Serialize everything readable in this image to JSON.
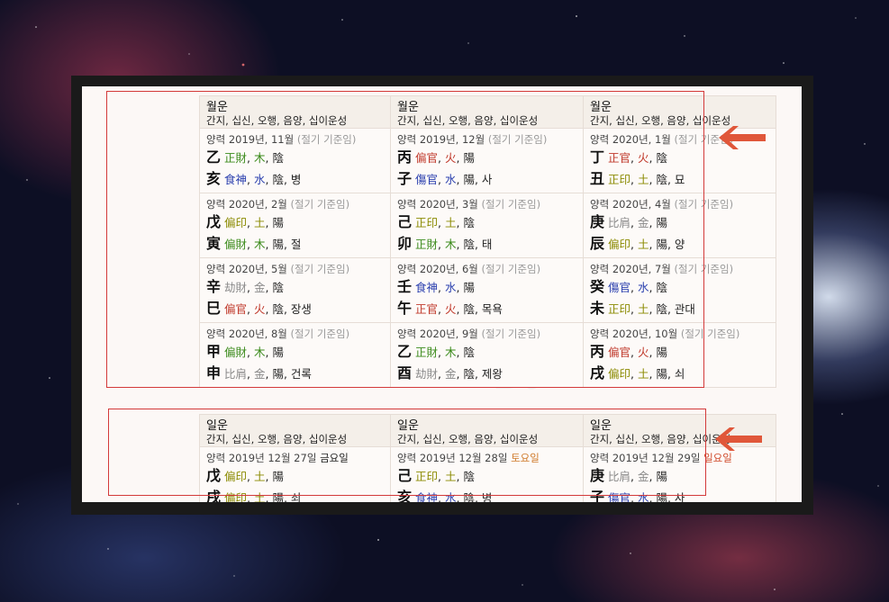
{
  "colors": {
    "green": "#3a8a1a",
    "blue": "#2a3fae",
    "red": "#c0392b",
    "olive": "#8a8a00",
    "gray": "#8a8a8a",
    "arrow": "#e0573a",
    "highlight": "#d33a3a"
  },
  "month_section": {
    "header": {
      "title": "월운",
      "subtitle": "간지, 십신, 오행, 음양, 십이운성"
    },
    "cells": [
      {
        "date": "양력 2019년, 11월",
        "note": "(절기 기준임)",
        "stem": {
          "char": "乙",
          "god": "正財",
          "god_color": "green",
          "el": "木",
          "el_color": "green",
          "yy": "陰",
          "stage": ""
        },
        "branch": {
          "char": "亥",
          "god": "食神",
          "god_color": "blue",
          "el": "水",
          "el_color": "blue",
          "yy": "陰",
          "stage": "병"
        }
      },
      {
        "date": "양력 2019년, 12월",
        "note": "(절기 기준임)",
        "stem": {
          "char": "丙",
          "god": "偏官",
          "god_color": "red",
          "el": "火",
          "el_color": "red",
          "yy": "陽",
          "stage": ""
        },
        "branch": {
          "char": "子",
          "god": "傷官",
          "god_color": "blue",
          "el": "水",
          "el_color": "blue",
          "yy": "陽",
          "stage": "사"
        }
      },
      {
        "date": "양력 2020년, 1월",
        "note": "(절기 기준임)",
        "stem": {
          "char": "丁",
          "god": "正官",
          "god_color": "red",
          "el": "火",
          "el_color": "red",
          "yy": "陰",
          "stage": ""
        },
        "branch": {
          "char": "丑",
          "god": "正印",
          "god_color": "olive",
          "el": "土",
          "el_color": "olive",
          "yy": "陰",
          "stage": "묘"
        }
      },
      {
        "date": "양력 2020년, 2월",
        "note": "(절기 기준임)",
        "stem": {
          "char": "戊",
          "god": "偏印",
          "god_color": "olive",
          "el": "土",
          "el_color": "olive",
          "yy": "陽",
          "stage": ""
        },
        "branch": {
          "char": "寅",
          "god": "偏財",
          "god_color": "green",
          "el": "木",
          "el_color": "green",
          "yy": "陽",
          "stage": "절"
        }
      },
      {
        "date": "양력 2020년, 3월",
        "note": "(절기 기준임)",
        "stem": {
          "char": "己",
          "god": "正印",
          "god_color": "olive",
          "el": "土",
          "el_color": "olive",
          "yy": "陰",
          "stage": ""
        },
        "branch": {
          "char": "卯",
          "god": "正財",
          "god_color": "green",
          "el": "木",
          "el_color": "green",
          "yy": "陰",
          "stage": "태"
        }
      },
      {
        "date": "양력 2020년, 4월",
        "note": "(절기 기준임)",
        "stem": {
          "char": "庚",
          "god": "比肩",
          "god_color": "gray",
          "el": "金",
          "el_color": "gray",
          "yy": "陽",
          "stage": ""
        },
        "branch": {
          "char": "辰",
          "god": "偏印",
          "god_color": "olive",
          "el": "土",
          "el_color": "olive",
          "yy": "陽",
          "stage": "양"
        }
      },
      {
        "date": "양력 2020년, 5월",
        "note": "(절기 기준임)",
        "stem": {
          "char": "辛",
          "god": "劫財",
          "god_color": "gray",
          "el": "金",
          "el_color": "gray",
          "yy": "陰",
          "stage": ""
        },
        "branch": {
          "char": "巳",
          "god": "偏官",
          "god_color": "red",
          "el": "火",
          "el_color": "red",
          "yy": "陰",
          "stage": "장생"
        }
      },
      {
        "date": "양력 2020년, 6월",
        "note": "(절기 기준임)",
        "stem": {
          "char": "壬",
          "god": "食神",
          "god_color": "blue",
          "el": "水",
          "el_color": "blue",
          "yy": "陽",
          "stage": ""
        },
        "branch": {
          "char": "午",
          "god": "正官",
          "god_color": "red",
          "el": "火",
          "el_color": "red",
          "yy": "陰",
          "stage": "목욕"
        }
      },
      {
        "date": "양력 2020년, 7월",
        "note": "(절기 기준임)",
        "stem": {
          "char": "癸",
          "god": "傷官",
          "god_color": "blue",
          "el": "水",
          "el_color": "blue",
          "yy": "陰",
          "stage": ""
        },
        "branch": {
          "char": "未",
          "god": "正印",
          "god_color": "olive",
          "el": "土",
          "el_color": "olive",
          "yy": "陰",
          "stage": "관대"
        }
      },
      {
        "date": "양력 2020년, 8월",
        "note": "(절기 기준임)",
        "stem": {
          "char": "甲",
          "god": "偏財",
          "god_color": "green",
          "el": "木",
          "el_color": "green",
          "yy": "陽",
          "stage": ""
        },
        "branch": {
          "char": "申",
          "god": "比肩",
          "god_color": "gray",
          "el": "金",
          "el_color": "gray",
          "yy": "陽",
          "stage": "건록"
        }
      },
      {
        "date": "양력 2020년, 9월",
        "note": "(절기 기준임)",
        "stem": {
          "char": "乙",
          "god": "正財",
          "god_color": "green",
          "el": "木",
          "el_color": "green",
          "yy": "陰",
          "stage": ""
        },
        "branch": {
          "char": "酉",
          "god": "劫財",
          "god_color": "gray",
          "el": "金",
          "el_color": "gray",
          "yy": "陰",
          "stage": "제왕"
        }
      },
      {
        "date": "양력 2020년, 10월",
        "note": "(절기 기준임)",
        "stem": {
          "char": "丙",
          "god": "偏官",
          "god_color": "red",
          "el": "火",
          "el_color": "red",
          "yy": "陽",
          "stage": ""
        },
        "branch": {
          "char": "戌",
          "god": "偏印",
          "god_color": "olive",
          "el": "土",
          "el_color": "olive",
          "yy": "陽",
          "stage": "쇠"
        }
      }
    ]
  },
  "day_section": {
    "header": {
      "title": "일운",
      "subtitle": "간지, 십신, 오행, 음양, 십이운성"
    },
    "cells": [
      {
        "date": "양력 2019년 12월 27일",
        "weekday": "금요일",
        "weekday_color": "#222222",
        "stem": {
          "char": "戊",
          "god": "偏印",
          "god_color": "olive",
          "el": "土",
          "el_color": "olive",
          "yy": "陽",
          "stage": ""
        },
        "branch": {
          "char": "戌",
          "god": "偏印",
          "god_color": "olive",
          "el": "土",
          "el_color": "olive",
          "yy": "陽",
          "stage": "쇠"
        }
      },
      {
        "date": "양력 2019년 12월 28일",
        "weekday": "토요일",
        "weekday_color": "#d07a2a",
        "stem": {
          "char": "己",
          "god": "正印",
          "god_color": "olive",
          "el": "土",
          "el_color": "olive",
          "yy": "陰",
          "stage": ""
        },
        "branch": {
          "char": "亥",
          "god": "食神",
          "god_color": "blue",
          "el": "水",
          "el_color": "blue",
          "yy": "陰",
          "stage": "병"
        }
      },
      {
        "date": "양력 2019년 12월 29일",
        "weekday": "일요일",
        "weekday_color": "#d04a2a",
        "stem": {
          "char": "庚",
          "god": "比肩",
          "god_color": "gray",
          "el": "金",
          "el_color": "gray",
          "yy": "陽",
          "stage": ""
        },
        "branch": {
          "char": "子",
          "god": "傷官",
          "god_color": "blue",
          "el": "水",
          "el_color": "blue",
          "yy": "陽",
          "stage": "사"
        }
      }
    ]
  }
}
